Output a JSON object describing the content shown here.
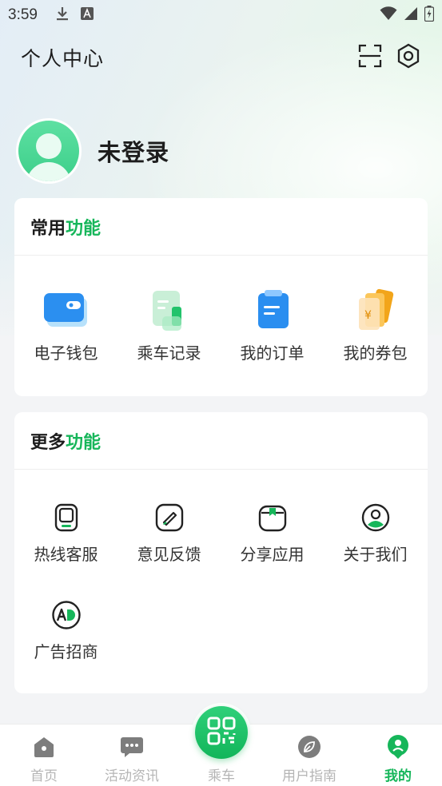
{
  "status_bar": {
    "time": "3:59",
    "left_icons": [
      "download-icon",
      "text-a-icon"
    ],
    "right_icons": [
      "wifi-icon",
      "signal-icon",
      "battery-charging-icon"
    ]
  },
  "header": {
    "title": "个人中心",
    "actions": [
      "scan-icon",
      "settings-icon"
    ]
  },
  "profile": {
    "name": "未登录"
  },
  "common_functions": {
    "title_prefix": "常用",
    "title_accent": "功能",
    "items": [
      {
        "label": "电子钱包",
        "icon": "wallet-icon"
      },
      {
        "label": "乘车记录",
        "icon": "ride-record-icon"
      },
      {
        "label": "我的订单",
        "icon": "order-icon"
      },
      {
        "label": "我的券包",
        "icon": "coupon-icon"
      }
    ]
  },
  "more_functions": {
    "title_prefix": "更多",
    "title_accent": "功能",
    "items": [
      {
        "label": "热线客服",
        "icon": "hotline-icon"
      },
      {
        "label": "意见反馈",
        "icon": "feedback-icon"
      },
      {
        "label": "分享应用",
        "icon": "share-icon"
      },
      {
        "label": "关于我们",
        "icon": "about-icon"
      },
      {
        "label": "广告招商",
        "icon": "ad-icon"
      }
    ]
  },
  "bottom_nav": {
    "items": [
      {
        "label": "首页",
        "icon": "home-icon",
        "active": false
      },
      {
        "label": "活动资讯",
        "icon": "chat-icon",
        "active": false
      },
      {
        "label": "乘车",
        "icon": "qr-code-icon",
        "active": false
      },
      {
        "label": "用户指南",
        "icon": "guide-icon",
        "active": false
      },
      {
        "label": "我的",
        "icon": "profile-icon",
        "active": true
      }
    ]
  },
  "colors": {
    "accent": "#16b65a",
    "inactive_nav": "#b5b5b5",
    "background": "#f3f4f6"
  }
}
